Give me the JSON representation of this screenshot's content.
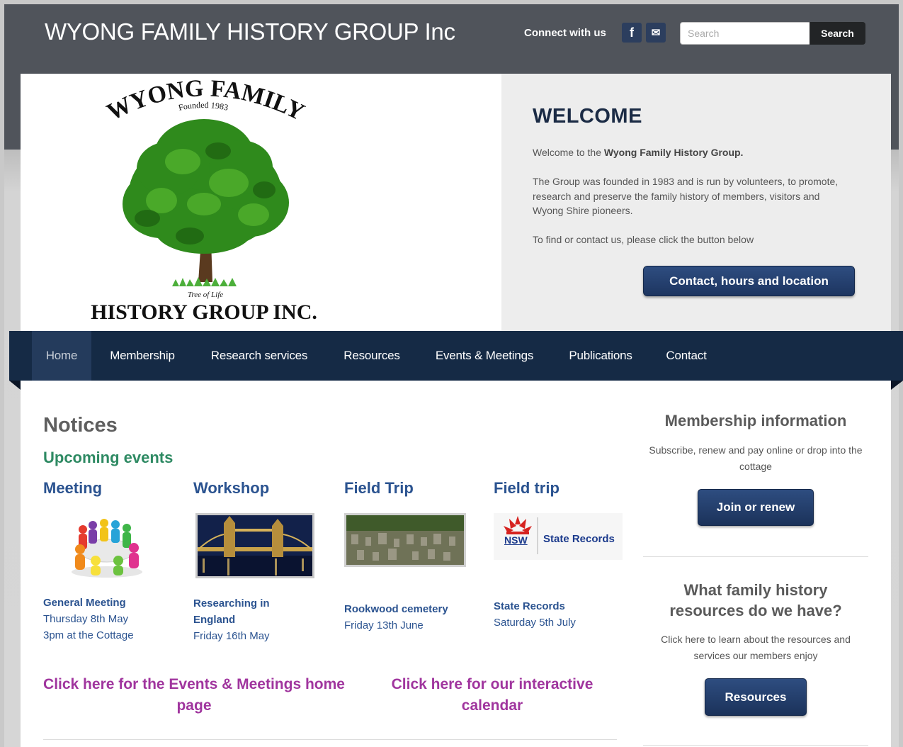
{
  "header": {
    "site_title": "WYONG FAMILY HISTORY GROUP Inc",
    "connect_label": "Connect with us",
    "social": [
      {
        "icon": "facebook-icon",
        "glyph": "f"
      },
      {
        "icon": "email-icon",
        "glyph": "✉"
      }
    ],
    "search": {
      "placeholder": "Search",
      "button_label": "Search"
    }
  },
  "logo": {
    "top_text": "WYONG FAMILY",
    "founded": "Founded 1983",
    "caption": "Tree of Life",
    "bottom_text": "HISTORY GROUP INC."
  },
  "welcome": {
    "title": "WELCOME",
    "intro_prefix": "Welcome to the ",
    "intro_bold": "Wyong Family History Group.",
    "para1": "The Group was founded in 1983 and is run by volunteers, to promote, research and preserve the family history of members, visitors and Wyong Shire pioneers.",
    "para2": "To find or contact us, please click the button below",
    "button_label": "Contact, hours and location"
  },
  "nav": {
    "items": [
      {
        "label": "Home",
        "active": true
      },
      {
        "label": "Membership"
      },
      {
        "label": "Research services"
      },
      {
        "label": "Resources"
      },
      {
        "label": "Events & Meetings"
      },
      {
        "label": "Publications"
      },
      {
        "label": "Contact"
      }
    ]
  },
  "notices": {
    "title": "Notices",
    "subtitle": "Upcoming events",
    "events": [
      {
        "heading": "Meeting",
        "title": "General Meeting",
        "details": [
          "Thursday 8th May",
          "3pm at the Cottage"
        ]
      },
      {
        "heading": "Workshop",
        "title": "Researching in England",
        "details": [
          "Friday 16th May"
        ]
      },
      {
        "heading": "Field Trip",
        "title": "Rookwood cemetery",
        "details": [
          "Friday 13th June"
        ]
      },
      {
        "heading": "Field trip",
        "title": "State Records",
        "details": [
          "Saturday 5th July"
        ]
      }
    ],
    "state_records_logo": {
      "nsw": "NSW",
      "name": "State Records"
    },
    "links": [
      "Click here for the Events & Meetings home page",
      "Click here for our interactive calendar"
    ]
  },
  "sidebar": {
    "membership": {
      "title": "Membership information",
      "text": "Subscribe, renew and pay online or drop into the cottage",
      "button_label": "Join or renew"
    },
    "resources": {
      "title": "What family history resources do we have?",
      "text": "Click here to learn about the resources and services our members enjoy",
      "button_label": "Resources"
    }
  },
  "colors": {
    "header_bg": "#50545b",
    "nav_bg": "#152a45",
    "button_blue": "#1d3560",
    "event_blue": "#2b5390",
    "green": "#2e8a63",
    "link_purple": "#a0359e"
  }
}
